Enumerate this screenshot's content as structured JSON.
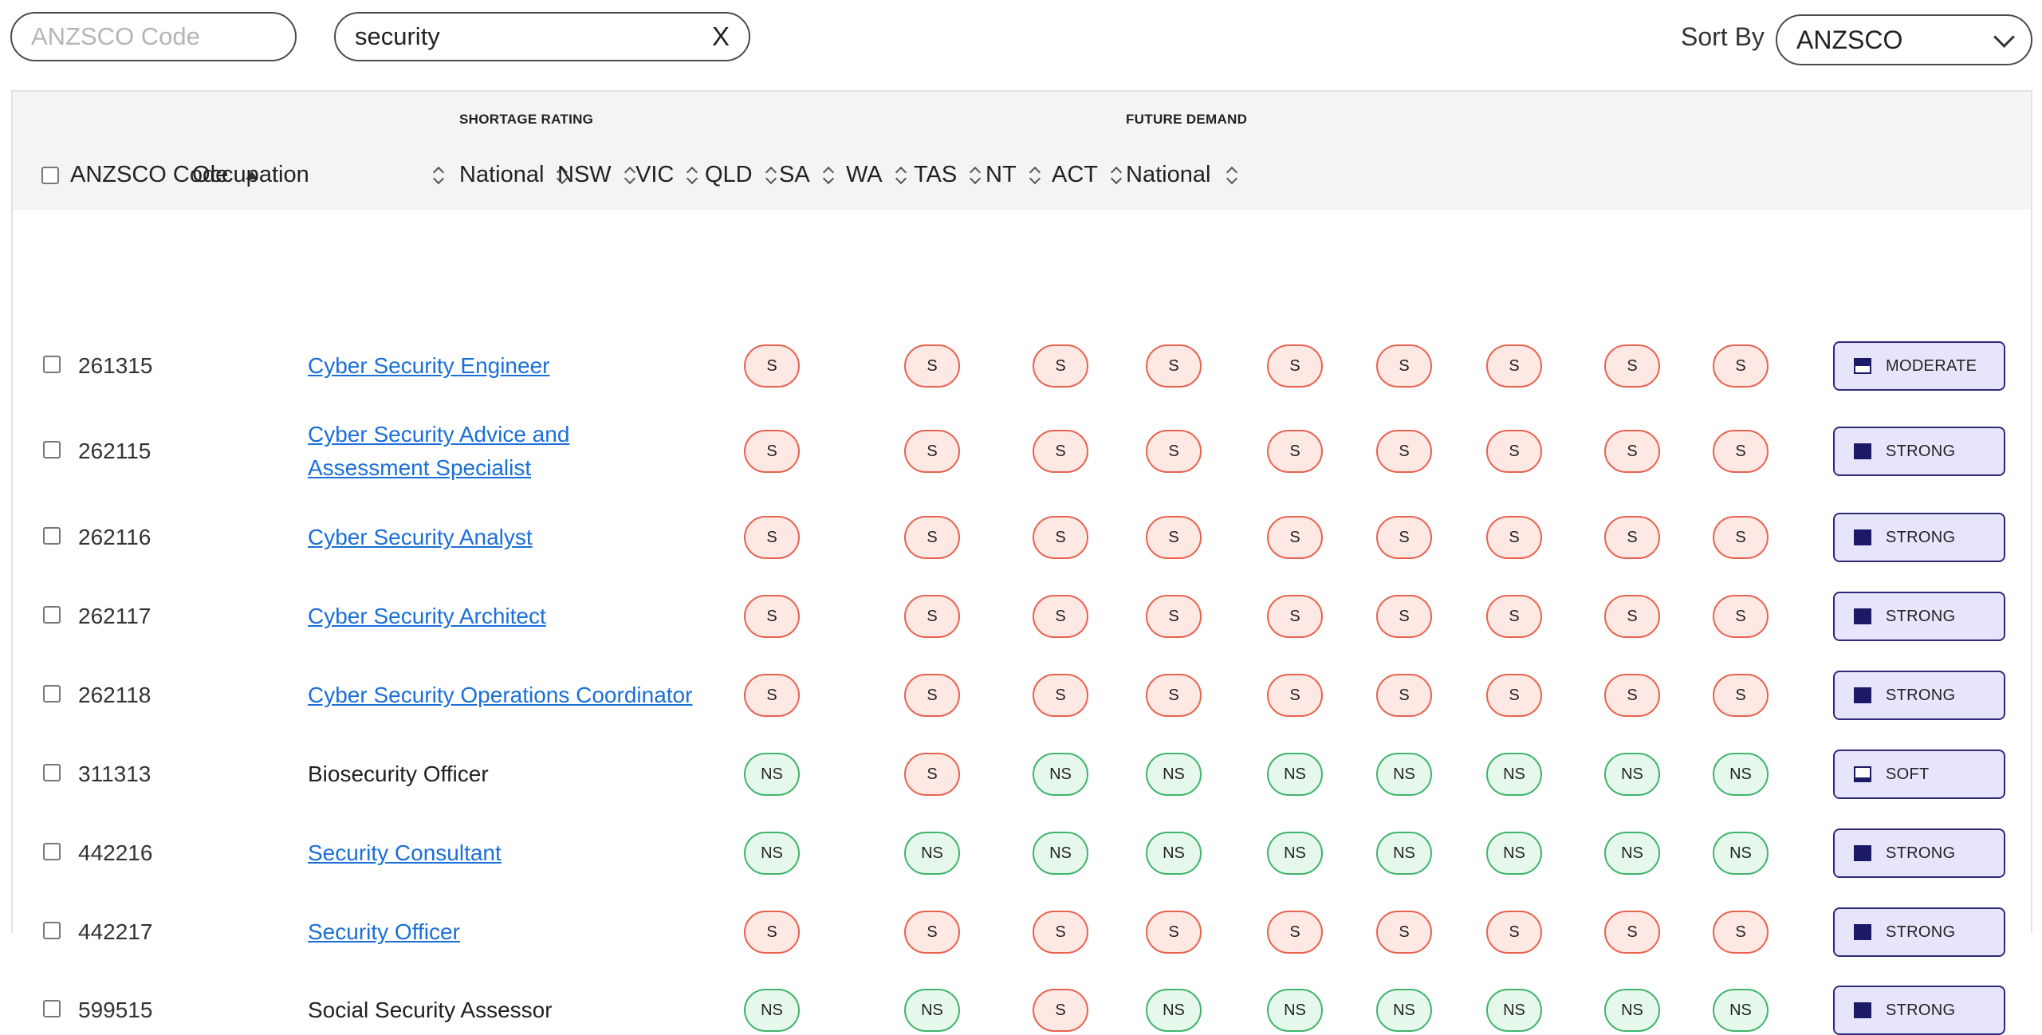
{
  "filters": {
    "code_placeholder": "ANZSCO Code",
    "search_value": "security",
    "clear_label": "X"
  },
  "sort": {
    "label": "Sort By",
    "selected": "ANZSCO"
  },
  "table": {
    "group_shortage": "SHORTAGE RATING",
    "group_future": "FUTURE DEMAND",
    "columns": {
      "code": "ANZSCO Code",
      "occupation": "Occupation",
      "national": "National",
      "nsw": "NSW",
      "vic": "VIC",
      "qld": "QLD",
      "sa": "SA",
      "wa": "WA",
      "tas": "TAS",
      "nt": "NT",
      "act": "ACT",
      "future_national": "National"
    },
    "rows": [
      {
        "code": "261315",
        "occupation": "Cyber Security Engineer",
        "link": true,
        "line2": "",
        "r": [
          "S",
          "S",
          "S",
          "S",
          "S",
          "S",
          "S",
          "S",
          "S"
        ],
        "demand": "MODERATE",
        "level": "moderate"
      },
      {
        "code": "262115",
        "occupation": "Cyber Security Advice and ",
        "link": true,
        "line2": "Assessment Specialist",
        "r": [
          "S",
          "S",
          "S",
          "S",
          "S",
          "S",
          "S",
          "S",
          "S"
        ],
        "demand": "STRONG",
        "level": "strong"
      },
      {
        "code": "262116",
        "occupation": "Cyber Security Analyst",
        "link": true,
        "line2": "",
        "r": [
          "S",
          "S",
          "S",
          "S",
          "S",
          "S",
          "S",
          "S",
          "S"
        ],
        "demand": "STRONG",
        "level": "strong"
      },
      {
        "code": "262117",
        "occupation": "Cyber Security Architect",
        "link": true,
        "line2": "",
        "r": [
          "S",
          "S",
          "S",
          "S",
          "S",
          "S",
          "S",
          "S",
          "S"
        ],
        "demand": "STRONG",
        "level": "strong"
      },
      {
        "code": "262118",
        "occupation": "Cyber Security Operations Coordinator",
        "link": true,
        "line2": "",
        "r": [
          "S",
          "S",
          "S",
          "S",
          "S",
          "S",
          "S",
          "S",
          "S"
        ],
        "demand": "STRONG",
        "level": "strong"
      },
      {
        "code": "311313",
        "occupation": "Biosecurity Officer",
        "link": false,
        "line2": "",
        "r": [
          "NS",
          "S",
          "NS",
          "NS",
          "NS",
          "NS",
          "NS",
          "NS",
          "NS"
        ],
        "demand": "SOFT",
        "level": "soft"
      },
      {
        "code": "442216",
        "occupation": "Security Consultant",
        "link": true,
        "line2": "",
        "r": [
          "NS",
          "NS",
          "NS",
          "NS",
          "NS",
          "NS",
          "NS",
          "NS",
          "NS"
        ],
        "demand": "STRONG",
        "level": "strong"
      },
      {
        "code": "442217",
        "occupation": "Security Officer",
        "link": true,
        "line2": "",
        "r": [
          "S",
          "S",
          "S",
          "S",
          "S",
          "S",
          "S",
          "S",
          "S"
        ],
        "demand": "STRONG",
        "level": "strong"
      },
      {
        "code": "599515",
        "occupation": "Social Security Assessor",
        "link": false,
        "line2": "",
        "r": [
          "NS",
          "NS",
          "S",
          "NS",
          "NS",
          "NS",
          "NS",
          "NS",
          "NS"
        ],
        "demand": "STRONG",
        "level": "strong"
      }
    ]
  }
}
